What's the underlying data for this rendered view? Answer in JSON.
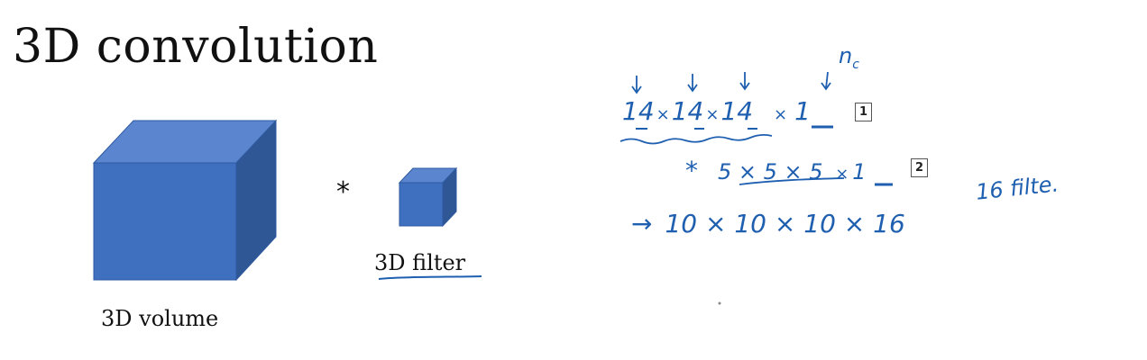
{
  "title": "3D convolution",
  "left": {
    "volume_label": "3D volume",
    "operator": "*",
    "filter_label": "3D filter",
    "cube_color": "#3f6fbf"
  },
  "notes": {
    "nc_label": "n",
    "nc_sub": "c",
    "line1": {
      "dims": [
        "14",
        "14",
        "14"
      ],
      "sep": "×",
      "channels_prefix": "×",
      "channels": "1",
      "box": "1"
    },
    "line2": {
      "prefix": "*",
      "expr": "5 × 5 × 5",
      "channels_prefix": "×",
      "channels": "1",
      "box": "2",
      "side_note": "16 filte."
    },
    "line3": {
      "arrow": "→",
      "expr": "10 × 10 × 10 × 16"
    },
    "ink_color": "#1f5fb0"
  }
}
